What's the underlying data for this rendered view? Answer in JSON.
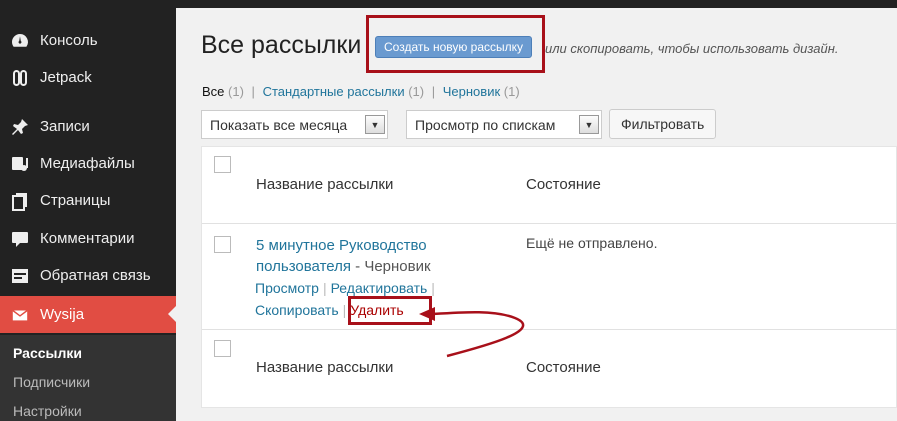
{
  "sidebar": {
    "items": [
      {
        "label": "Консоль",
        "icon": "dashboard-icon"
      },
      {
        "label": "Jetpack",
        "icon": "jetpack-icon"
      },
      {
        "label": "Записи",
        "icon": "pin-icon"
      },
      {
        "label": "Медиафайлы",
        "icon": "media-icon"
      },
      {
        "label": "Страницы",
        "icon": "pages-icon"
      },
      {
        "label": "Комментарии",
        "icon": "comment-icon"
      },
      {
        "label": "Обратная связь",
        "icon": "feedback-icon"
      },
      {
        "label": "Wysija",
        "icon": "envelope-icon"
      }
    ],
    "submenu": [
      "Рассылки",
      "Подписчики",
      "Настройки"
    ]
  },
  "header": {
    "title": "Все рассылки",
    "add_button": "Создать новую рассылку",
    "hint": "или скопировать, чтобы использовать дизайн."
  },
  "filters": {
    "all_label": "Все",
    "all_count": "(1)",
    "standard_label": "Стандартные рассылки",
    "standard_count": "(1)",
    "draft_label": "Черновик",
    "draft_count": "(1)",
    "months_select": "Показать все месяца",
    "lists_select": "Просмотр по спискам",
    "filter_button": "Фильтровать"
  },
  "table": {
    "col_name": "Название рассылки",
    "col_state": "Состояние",
    "row": {
      "title": "5 минутное Руководство пользователя",
      "status": " - Черновик",
      "state": "Ещё не отправлено.",
      "actions": {
        "view": "Просмотр",
        "edit": "Редактировать",
        "copy": "Скопировать",
        "delete": "Удалить"
      }
    }
  },
  "colors": {
    "sidebar_bg": "#222222",
    "active_bg": "#e14d43",
    "link": "#21759b",
    "annotation": "#a8101a"
  }
}
